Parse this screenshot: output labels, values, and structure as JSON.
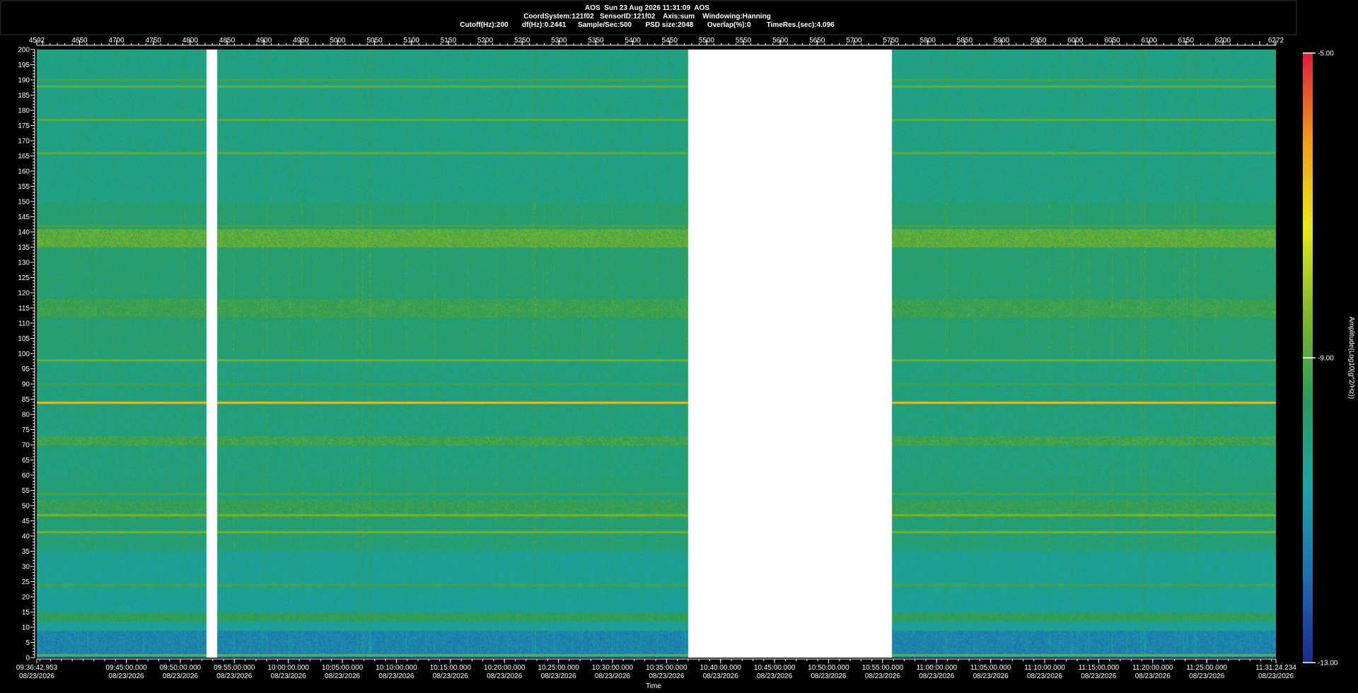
{
  "header": {
    "line1": "AOS  Sun 23 Aug 2026 11:31:09  AOS",
    "line2": "CoordSystem:121f02   SensorID:121f02    Axis:sum    Windowing:Hanning",
    "line3": "Cutoff(Hz):200       df(Hz):0.2441      Sample/Sec:500       PSD size:2048       Overlap(%):0        TimeRes.(sec):4.096"
  },
  "chart_data": {
    "type": "heatmap",
    "title": "AOS  Sun 23 Aug 2026 11:31:09  AOS",
    "xlabel": "Time",
    "ylabel": "",
    "colorbar_label": "Amplitude(Log10(g^2/Hz))",
    "colorbar_ticks": [
      "-5.00",
      "-9.00",
      "-13.00"
    ],
    "colorbar_range": [
      -13,
      -5
    ],
    "colormap": [
      "#1a2a8c",
      "#1f6fb0",
      "#1aa5a5",
      "#2a9a5a",
      "#7fb82a",
      "#e8e81e",
      "#f39a14",
      "#e01a3c"
    ],
    "ylim": [
      0,
      200
    ],
    "y_ticks": [
      0,
      5,
      10,
      15,
      20,
      25,
      30,
      35,
      40,
      45,
      50,
      55,
      60,
      65,
      70,
      75,
      80,
      85,
      90,
      95,
      100,
      105,
      110,
      115,
      120,
      125,
      130,
      135,
      140,
      145,
      150,
      155,
      160,
      165,
      170,
      175,
      180,
      185,
      190,
      195,
      200
    ],
    "index_range": [
      4592,
      6272
    ],
    "top_ticks": [
      "4592",
      "4650",
      "4700",
      "4750",
      "4800",
      "4850",
      "4900",
      "4950",
      "5000",
      "5050",
      "5100",
      "5150",
      "5200",
      "5250",
      "5300",
      "5350",
      "5400",
      "5450",
      "5500",
      "5550",
      "5600",
      "5650",
      "5700",
      "5750",
      "5800",
      "5850",
      "5900",
      "5950",
      "6000",
      "6050",
      "6100",
      "6150",
      "6200",
      "6272"
    ],
    "top_tick_values": [
      4592,
      4650,
      4700,
      4750,
      4800,
      4850,
      4900,
      4950,
      5000,
      5050,
      5100,
      5150,
      5200,
      5250,
      5300,
      5350,
      5400,
      5450,
      5500,
      5550,
      5600,
      5650,
      5700,
      5750,
      5800,
      5850,
      5900,
      5950,
      6000,
      6050,
      6100,
      6150,
      6200,
      6272
    ],
    "time_range_sec": [
      34602.953,
      41484.234
    ],
    "time_ticks": [
      {
        "t": 34602.953,
        "label": "09:36:42.953"
      },
      {
        "t": 35100,
        "label": "09:45:00.000"
      },
      {
        "t": 35400,
        "label": "09:50:00.000"
      },
      {
        "t": 35700,
        "label": "09:55:00.000"
      },
      {
        "t": 36000,
        "label": "10:00:00.000"
      },
      {
        "t": 36300,
        "label": "10:05:00.000"
      },
      {
        "t": 36600,
        "label": "10:10:00.000"
      },
      {
        "t": 36900,
        "label": "10:15:00.000"
      },
      {
        "t": 37200,
        "label": "10:20:00.000"
      },
      {
        "t": 37500,
        "label": "10:25:00.000"
      },
      {
        "t": 37800,
        "label": "10:30:00.000"
      },
      {
        "t": 38100,
        "label": "10:35:00.000"
      },
      {
        "t": 38400,
        "label": "10:40:00.000"
      },
      {
        "t": 38700,
        "label": "10:45:00.000"
      },
      {
        "t": 39000,
        "label": "10:50:00.000"
      },
      {
        "t": 39300,
        "label": "10:55:00.000"
      },
      {
        "t": 39600,
        "label": "11:00:00.000"
      },
      {
        "t": 39900,
        "label": "11:05:00.000"
      },
      {
        "t": 40200,
        "label": "11:10:00.000"
      },
      {
        "t": 40500,
        "label": "11:15:00.000"
      },
      {
        "t": 40800,
        "label": "11:20:00.000"
      },
      {
        "t": 41100,
        "label": "11:25:00.000"
      },
      {
        "t": 41484.234,
        "label": "11:31:24.234"
      }
    ],
    "date_label": "08/23/2026",
    "data_gaps_index": [
      [
        4822,
        4836
      ],
      [
        5475,
        5751
      ]
    ],
    "tonal_lines": [
      {
        "freq_hz": 1,
        "level": -8.8
      },
      {
        "freq_hz": 24,
        "level": -9.2
      },
      {
        "freq_hz": 41.5,
        "level": -8.6
      },
      {
        "freq_hz": 47,
        "level": -8.6
      },
      {
        "freq_hz": 54,
        "level": -9.2
      },
      {
        "freq_hz": 84,
        "level": -6.6
      },
      {
        "freq_hz": 90,
        "level": -9.3
      },
      {
        "freq_hz": 98,
        "level": -8.7
      },
      {
        "freq_hz": 142,
        "level": -9.2
      },
      {
        "freq_hz": 166,
        "level": -8.9
      },
      {
        "freq_hz": 177,
        "level": -8.9
      },
      {
        "freq_hz": 188,
        "level": -8.8
      },
      {
        "freq_hz": 190,
        "level": -9.2
      }
    ],
    "broadband_bands": [
      {
        "from_hz": 135,
        "to_hz": 141,
        "level": -8.9
      },
      {
        "from_hz": 112,
        "to_hz": 118,
        "level": -9.4
      },
      {
        "from_hz": 70,
        "to_hz": 73,
        "level": -9.3
      },
      {
        "from_hz": 46,
        "to_hz": 52,
        "level": -9.5
      },
      {
        "from_hz": 12,
        "to_hz": 15,
        "level": -9.6
      }
    ],
    "background": [
      {
        "from_hz": 0,
        "to_hz": 9,
        "level": -11.4
      },
      {
        "from_hz": 9,
        "to_hz": 20,
        "level": -10.6
      },
      {
        "from_hz": 20,
        "to_hz": 35,
        "level": -10.5
      },
      {
        "from_hz": 35,
        "to_hz": 60,
        "level": -10.0
      },
      {
        "from_hz": 60,
        "to_hz": 100,
        "level": -10.1
      },
      {
        "from_hz": 100,
        "to_hz": 150,
        "level": -9.9
      },
      {
        "from_hz": 150,
        "to_hz": 200,
        "level": -10.2
      }
    ]
  }
}
